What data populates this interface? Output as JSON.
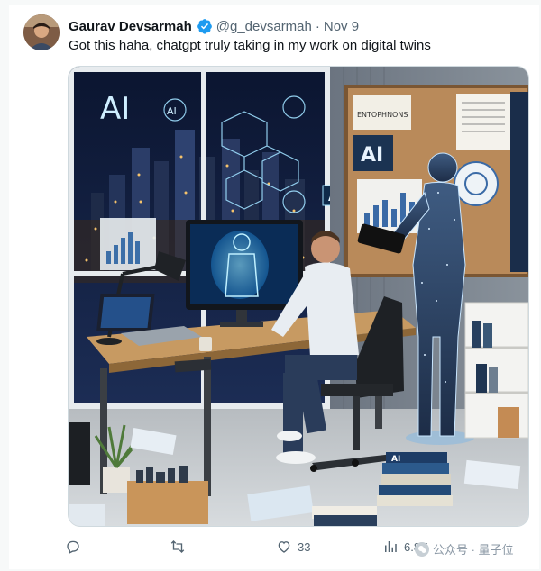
{
  "tweet": {
    "author": {
      "display_name": "Gaurav Devsarmah",
      "handle": "@g_devsarmah",
      "verified": true,
      "avatar_icon": "user-avatar"
    },
    "separator": "·",
    "date": "Nov 9",
    "text": "Got this haha, chatgpt truly taking in my work on digital twins",
    "media": {
      "type": "image",
      "signs": {
        "ai_big": "AI",
        "ai_circle": "AI",
        "ai_small": "AI",
        "ai_board": "AI",
        "board_note": "ENTOPHNONS",
        "book_label": "AI"
      }
    },
    "actions": {
      "reply": {
        "icon": "reply-icon",
        "count": ""
      },
      "retweet": {
        "icon": "retweet-icon",
        "count": ""
      },
      "like": {
        "icon": "heart-icon",
        "count": "33"
      },
      "views": {
        "icon": "views-icon",
        "count": "6.8K"
      }
    }
  },
  "watermark": {
    "text": "公众号 · 量子位"
  },
  "colors": {
    "text_primary": "#0f1419",
    "text_secondary": "#536471",
    "verified_blue": "#1d9bf0",
    "border": "#cfd9de"
  }
}
